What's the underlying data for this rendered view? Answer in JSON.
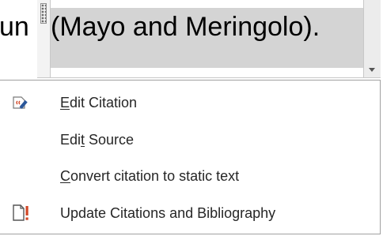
{
  "document": {
    "preceding_text": "un",
    "citation_text": "(Mayo and Meringolo)."
  },
  "context_menu": {
    "items": [
      {
        "label_before": "",
        "label_access_key": "E",
        "label_after": "dit Citation",
        "icon": "edit-citation-icon",
        "accent_color": "#d24726"
      },
      {
        "label_before": "Edi",
        "label_access_key": "t",
        "label_after": " Source",
        "icon": ""
      },
      {
        "label_before": "",
        "label_access_key": "C",
        "label_after": "onvert citation to static text",
        "icon": ""
      },
      {
        "label_before": "Update Citations and Bibliography",
        "label_access_key": "",
        "label_after": "",
        "icon": "update-fields-icon",
        "accent_color": "#d24726"
      }
    ]
  },
  "colors": {
    "highlight": "#d4d4d4",
    "menu_text": "#262626",
    "icon_blue": "#2b579a",
    "icon_orange": "#d24726"
  }
}
